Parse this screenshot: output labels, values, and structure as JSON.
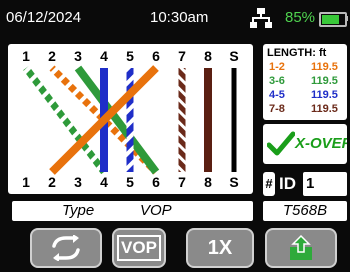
{
  "status_bar": {
    "date": "06/12/2024",
    "time": "10:30am",
    "network_icon": "network-icon",
    "battery_text": "85%",
    "battery_level_percent": 85
  },
  "wire_map": {
    "pins_top": [
      "1",
      "2",
      "3",
      "4",
      "5",
      "6",
      "7",
      "8",
      "S"
    ],
    "pins_bottom": [
      "1",
      "2",
      "3",
      "4",
      "5",
      "6",
      "7",
      "8",
      "S"
    ]
  },
  "length": {
    "header": "LENGTH: ft",
    "rows": [
      {
        "pair": "1-2",
        "value": "119.5",
        "color": "#e8720c"
      },
      {
        "pair": "3-6",
        "value": "119.5",
        "color": "#2e9a3a"
      },
      {
        "pair": "4-5",
        "value": "119.5",
        "color": "#1f2ec8"
      },
      {
        "pair": "7-8",
        "value": "119.5",
        "color": "#6b2a1a"
      }
    ]
  },
  "result": {
    "label": "X-OVER",
    "icon": "checkmark-icon"
  },
  "id": {
    "badge": "#",
    "label": "ID",
    "value": "1"
  },
  "type_bar": {
    "type_label": "Type",
    "vop_label": "VOP",
    "standard": "T568B"
  },
  "softkeys": [
    {
      "name": "refresh-button",
      "label": "",
      "icon": "refresh-icon"
    },
    {
      "name": "vop-button",
      "label": "VOP",
      "icon": ""
    },
    {
      "name": "1x-button",
      "label": "1X",
      "icon": ""
    },
    {
      "name": "export-button",
      "label": "",
      "icon": "export-icon"
    }
  ],
  "colors": {
    "orange": "#e8720c",
    "green": "#2e9a3a",
    "blue": "#1f2ec8",
    "brown": "#6b2a1a",
    "accent_green": "#1a9e1a"
  }
}
